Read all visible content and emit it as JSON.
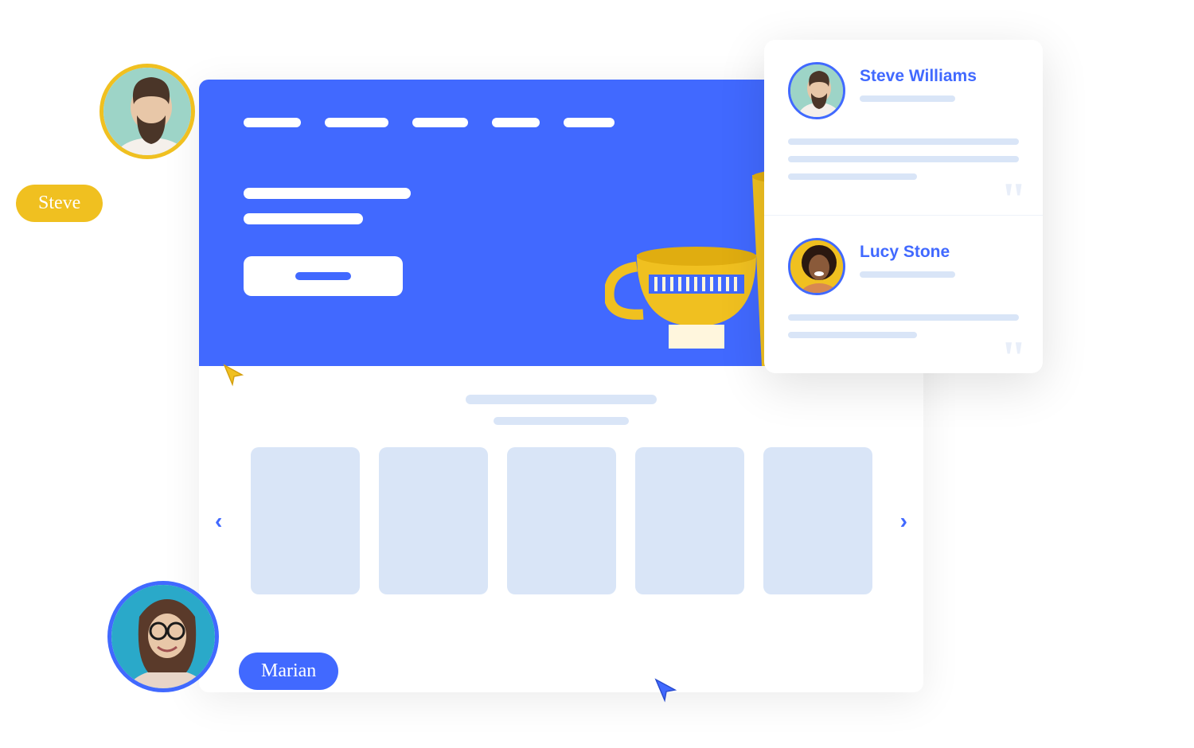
{
  "collaborators": {
    "steve": {
      "name": "Steve"
    },
    "marian": {
      "name": "Marian"
    }
  },
  "testimonials": [
    {
      "name": "Steve Williams"
    },
    {
      "name": "Lucy Stone"
    }
  ],
  "carousel": {
    "card_count": 5
  },
  "colors": {
    "primary": "#4169ff",
    "accent": "#f0c020",
    "placeholder": "#d9e5f7"
  }
}
